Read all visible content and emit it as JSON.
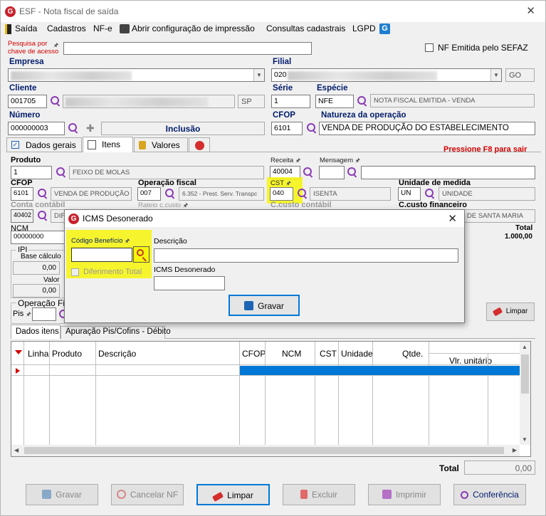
{
  "window": {
    "title": "ESF - Nota fiscal de saída",
    "logo_letter": "G"
  },
  "menu": [
    "Saída",
    "Cadastros",
    "NF-e",
    "Abrir configuração de impressão",
    "Consultas cadastrais",
    "LGPD"
  ],
  "search": {
    "label_line1": "Pesquisa por",
    "label_line2": "chave de acesso",
    "value": ""
  },
  "nf_sefaz": {
    "label": "NF Emitida pelo SEFAZ",
    "checked": false
  },
  "empresa": {
    "label": "Empresa"
  },
  "filial": {
    "label": "Filial",
    "code_prefix": "020",
    "uf": "GO"
  },
  "cliente": {
    "label": "Cliente",
    "code": "001705",
    "uf": "SP"
  },
  "serie": {
    "label": "Série",
    "value": "1"
  },
  "especie": {
    "label": "Espécie",
    "code": "NFE",
    "desc": "NOTA FISCAL EMITIDA - VENDA"
  },
  "numero": {
    "label": "Número",
    "value": "000000003",
    "status": "Inclusão"
  },
  "cfop_top": {
    "label": "CFOP",
    "value": "6101"
  },
  "natureza": {
    "label": "Natureza da operação",
    "value": "VENDA DE PRODUÇÃO DO ESTABELECIMENTO"
  },
  "tabs": [
    "Dados gerais",
    "Itens",
    "Valores"
  ],
  "f8_hint": "Pressione F8 para sair",
  "item": {
    "produto_label": "Produto",
    "produto_code": "1",
    "produto_desc": "FEIXO DE MOLAS",
    "receita_label": "Receita",
    "receita_code": "40004",
    "mensagem_label": "Mensagem",
    "cfop_label": "CFOP",
    "cfop_code": "6101",
    "cfop_desc": "VENDA DE PRODUÇÃO D",
    "operacao_label": "Operação fiscal",
    "operacao_code": "007",
    "operacao_desc": "6.352 - Prest. Serv. Transpc",
    "cst_label": "CST",
    "cst_code": "040",
    "cst_desc": "ISENTA",
    "unidade_label": "Unidade de medida",
    "unidade_code": "UN",
    "unidade_desc": "UNIDADE",
    "conta_label": "Conta contábil",
    "conta_code": "40402",
    "conta_desc": "DIF",
    "rateio_label": "Rateio c.custo",
    "ccusto_label": "C.custo contábil",
    "ccusto_fin_label": "C.custo financeiro",
    "ccusto_fin_desc": "DE SANTA MARIA",
    "ncm_label": "NCM",
    "ncm_value": "00000000",
    "total_label": "Total",
    "total_value": "1.000,00",
    "ipi_label": "IPI",
    "base_label": "Base cálculo",
    "base_value": "0,00",
    "valor_label": "Valor",
    "valor_value": "0,00",
    "opfis_label": "Operação Fis",
    "pis_label": "Pis",
    "limpar_label": "Limpar"
  },
  "subtabs": [
    "Dados itens",
    "Apuração Pis/Cofins - Débito"
  ],
  "grid": {
    "columns": [
      "Linha",
      "Produto",
      "Descrição",
      "CFOP",
      "NCM",
      "CST",
      "Unidade",
      "Qtde.",
      "Vlr. unitário"
    ]
  },
  "footer_total": {
    "label": "Total",
    "value": "0,00"
  },
  "buttons": [
    "Gravar",
    "Cancelar NF",
    "Limpar",
    "Excluir",
    "Imprimir",
    "Conferência"
  ],
  "modal": {
    "title": "ICMS Desonerado",
    "codigo_label": "Código Benefício",
    "codigo_value": "",
    "descricao_label": "Descrição",
    "descricao_value": "",
    "diferimento_label": "Diferimento Total",
    "icms_label": "ICMS Desonerado",
    "icms_value": "",
    "gravar_label": "Gravar"
  },
  "colors": {
    "label_blue": "#001c6b",
    "highlight": "#f7f60a",
    "accent_red": "#d30000",
    "selection_blue": "#0078d7",
    "icon_purple": "#8b3bb5"
  }
}
